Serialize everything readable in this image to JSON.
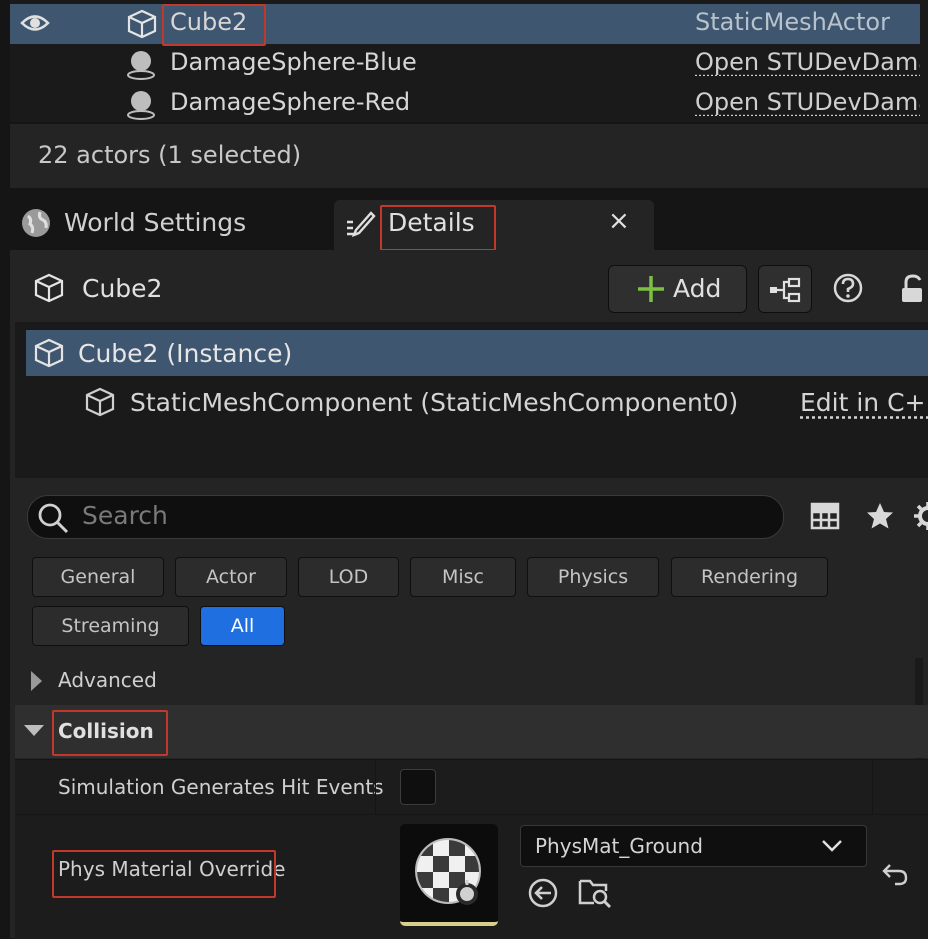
{
  "outliner": {
    "rows": [
      {
        "name": "Cube2",
        "type": "StaticMeshActor",
        "selected": true
      },
      {
        "name": "DamageSphere-Blue",
        "type": "Open STUDevDamageSphere"
      },
      {
        "name": "DamageSphere-Red",
        "type": "Open STUDevDamageSphere"
      }
    ],
    "status": "22 actors (1 selected)"
  },
  "tabs": {
    "world_settings": "World Settings",
    "details": "Details",
    "close_glyph": "×"
  },
  "details": {
    "actor_name": "Cube2",
    "add_label": "Add",
    "instance_label": "Cube2 (Instance)",
    "component_label": "StaticMeshComponent (StaticMeshComponent0)",
    "edit_link": "Edit in C++",
    "search_placeholder": "Search",
    "filters": [
      "General",
      "Actor",
      "LOD",
      "Misc",
      "Physics",
      "Rendering",
      "Streaming",
      "All"
    ],
    "active_filter": "All",
    "advanced_label": "Advanced",
    "collision_label": "Collision",
    "sim_hit_label": "Simulation Generates Hit Events",
    "sim_hit_checked": false,
    "phys_override_label": "Phys Material Override",
    "phys_material_value": "PhysMat_Ground"
  },
  "colors": {
    "selection": "#3e566f",
    "accent_blue": "#1f6fe0",
    "add_green": "#7bc043",
    "highlight_red": "#c0392b"
  }
}
